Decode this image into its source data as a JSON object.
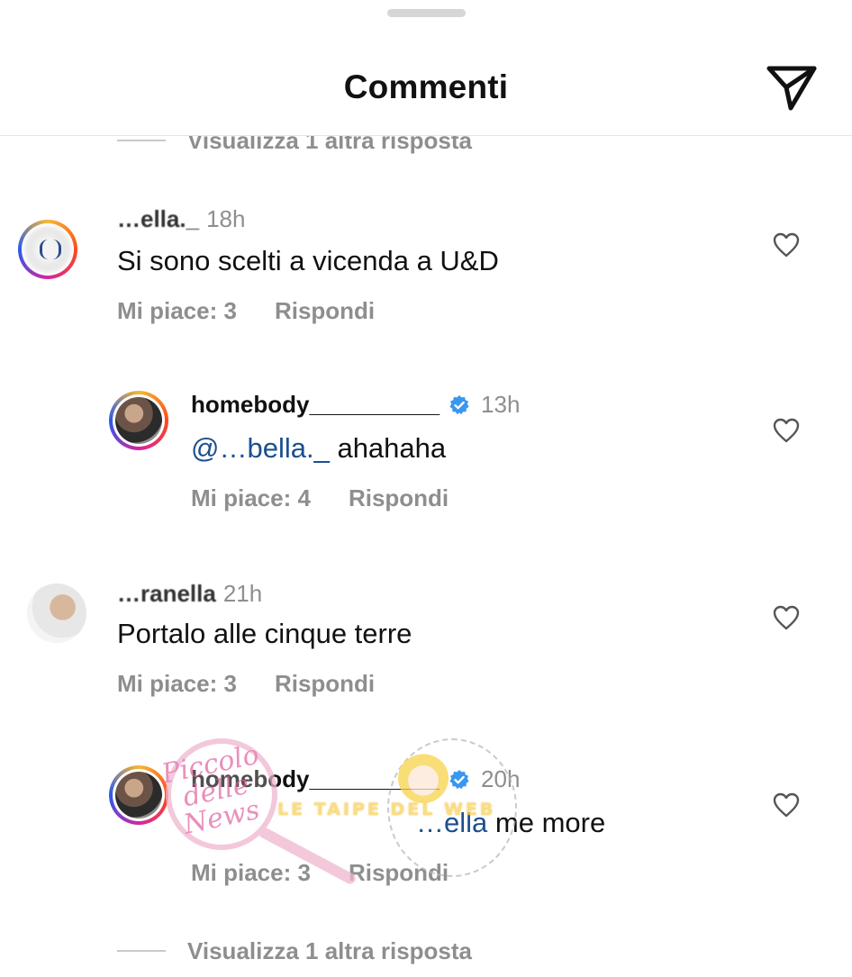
{
  "header": {
    "title": "Commenti",
    "share_icon": "paper-plane-icon"
  },
  "view_more_replies": {
    "top_label": "Visualizza 1 altra risposta",
    "bottom_label": "Visualizza 1 altra risposta"
  },
  "comments": [
    {
      "username": "…ella._",
      "time": "18h",
      "text": "Si sono scelti a vicenda a U&D",
      "likes": "Mi piace: 3",
      "reply": "Rispondi",
      "is_reply": false
    },
    {
      "username": "homebody__________",
      "verified": true,
      "time": "13h",
      "mention": "@…bella._",
      "text": "ahahaha",
      "likes": "Mi piace: 4",
      "reply": "Rispondi",
      "is_reply": true
    },
    {
      "username": "…ranella",
      "time": "21h",
      "text": "Portalo alle cinque terre",
      "likes": "Mi piace: 3",
      "reply": "Rispondi",
      "is_reply": false
    },
    {
      "username": "homebody__________",
      "verified": true,
      "time": "20h",
      "mention": "…ella",
      "text": "me more",
      "likes": "Mi piace: 3",
      "reply": "Rispondi",
      "is_reply": true
    }
  ],
  "watermark": {
    "logo_text": "Piccolo delle News",
    "banner_text": "LE TAIPE DEL WEB"
  },
  "colors": {
    "text_primary": "#111111",
    "text_secondary": "#8e8e8e",
    "mention": "#1b4f8f",
    "verified": "#3897f0",
    "divider": "#e6e6e6"
  }
}
